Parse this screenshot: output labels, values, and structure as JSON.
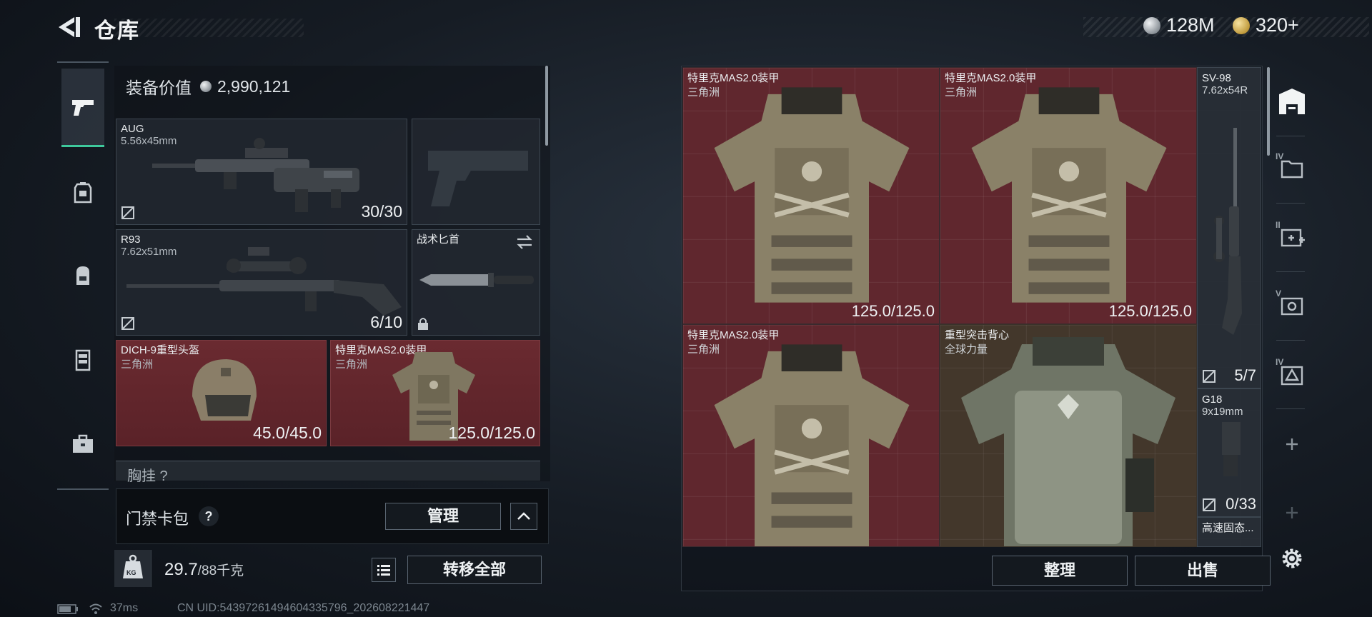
{
  "header": {
    "title": "仓库",
    "currency_silver": "128M",
    "currency_gold": "320+"
  },
  "left_nav": {
    "items": [
      "pistol-icon",
      "backpack-slot-icon",
      "bag-icon",
      "rig-icon",
      "case-icon"
    ],
    "active": 0
  },
  "equipment": {
    "value_label": "装备价值",
    "value": "2,990,121",
    "slots": [
      {
        "name": "AUG",
        "sub": "5.56x45mm",
        "count": "30/30"
      },
      {
        "name": "",
        "sub": "",
        "count": ""
      },
      {
        "name": "R93",
        "sub": "7.62x51mm",
        "count": "6/10"
      },
      {
        "name": "战术匕首",
        "sub": "",
        "count": ""
      },
      {
        "name": "DICH-9重型头盔",
        "sub": "三角洲",
        "count": "45.0/45.0"
      },
      {
        "name": "特里克MAS2.0装甲",
        "sub": "三角洲",
        "count": "125.0/125.0"
      }
    ],
    "chest_label": "胸挂 ?"
  },
  "keycard": {
    "label": "门禁卡包",
    "help": "?",
    "manage": "管理"
  },
  "weight": {
    "icon_text": "KG",
    "current": "29.7",
    "max": "/88千克",
    "transfer_all": "转移全部"
  },
  "status": {
    "ping": "37ms",
    "uid": "CN UID:5439726149460433​5796_202608221447"
  },
  "stash": {
    "items": [
      {
        "name": "特里克MAS2.0装甲",
        "sub": "三角洲",
        "count": "125.0/125.0"
      },
      {
        "name": "特里克MAS2.0装甲",
        "sub": "三角洲",
        "count": "125.0/125.0"
      },
      {
        "name": "SV-98",
        "sub": "7.62x54R",
        "count": "5/7"
      },
      {
        "name": "特里克MAS2.0装甲",
        "sub": "三角洲",
        "count": ""
      },
      {
        "name": "重型突击背心",
        "sub": "全球力量",
        "count": ""
      },
      {
        "name": "G18",
        "sub": "9x19mm",
        "count": "0/33"
      },
      {
        "name": "高速固态...",
        "sub": "",
        "count": ""
      }
    ],
    "sort": "整理",
    "sell": "出售"
  },
  "right_rail": {
    "tiers": [
      "IV",
      "II",
      "V",
      "IV"
    ]
  },
  "colors": {
    "accent_green": "#3ec99c",
    "red_rarity": "#6a2a30",
    "gold_rarity": "#483a2c"
  }
}
